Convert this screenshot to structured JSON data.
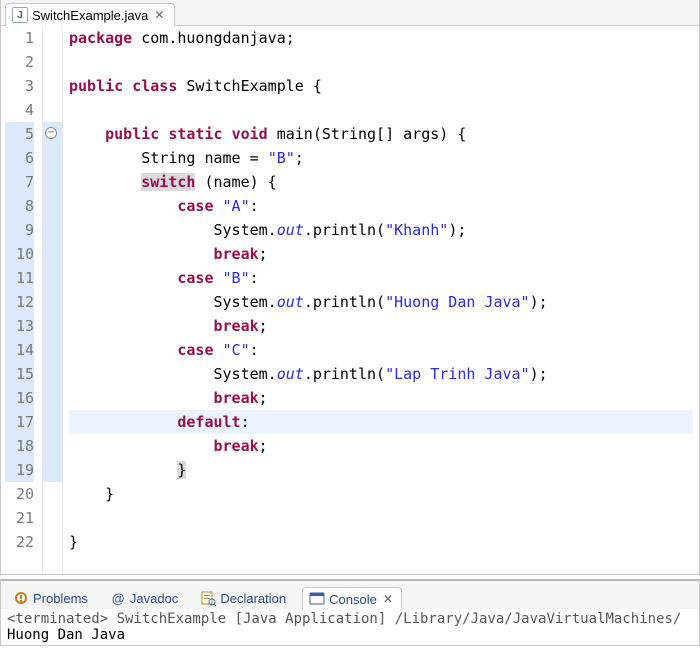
{
  "editor": {
    "tab": {
      "filename": "SwitchExample.java"
    },
    "lines": [
      {
        "n": 1,
        "segs": [
          [
            "kw",
            "package"
          ],
          [
            "pkg",
            " com.huongdanjava;"
          ]
        ]
      },
      {
        "n": 2,
        "segs": [
          [
            "",
            ""
          ]
        ]
      },
      {
        "n": 3,
        "segs": [
          [
            "kw",
            "public"
          ],
          [
            "",
            " "
          ],
          [
            "kw",
            "class"
          ],
          [
            "cls",
            " SwitchExample {"
          ]
        ]
      },
      {
        "n": 4,
        "segs": [
          [
            "",
            ""
          ]
        ]
      },
      {
        "n": 5,
        "fold": true,
        "bar": true,
        "segs": [
          [
            "",
            "    "
          ],
          [
            "kw",
            "public"
          ],
          [
            "",
            " "
          ],
          [
            "kw",
            "static"
          ],
          [
            "",
            " "
          ],
          [
            "kw",
            "void"
          ],
          [
            "",
            " main(String[] args) {"
          ]
        ]
      },
      {
        "n": 6,
        "bar": true,
        "segs": [
          [
            "",
            "        String name = "
          ],
          [
            "str",
            "\"B\""
          ],
          [
            "",
            ";"
          ]
        ]
      },
      {
        "n": 7,
        "bar": true,
        "segs": [
          [
            "",
            "        "
          ],
          [
            "kw box-hl",
            "switch"
          ],
          [
            "",
            " (name) {"
          ]
        ]
      },
      {
        "n": 8,
        "bar": true,
        "segs": [
          [
            "",
            "            "
          ],
          [
            "kw",
            "case"
          ],
          [
            "",
            " "
          ],
          [
            "str",
            "\"A\""
          ],
          [
            "",
            ":"
          ]
        ]
      },
      {
        "n": 9,
        "bar": true,
        "segs": [
          [
            "",
            "                System."
          ],
          [
            "field",
            "out"
          ],
          [
            "",
            ".println("
          ],
          [
            "str",
            "\"Khanh\""
          ],
          [
            "",
            ");"
          ]
        ]
      },
      {
        "n": 10,
        "bar": true,
        "segs": [
          [
            "",
            "                "
          ],
          [
            "kw",
            "break"
          ],
          [
            "",
            ";"
          ]
        ]
      },
      {
        "n": 11,
        "bar": true,
        "segs": [
          [
            "",
            "            "
          ],
          [
            "kw",
            "case"
          ],
          [
            "",
            " "
          ],
          [
            "str",
            "\"B\""
          ],
          [
            "",
            ":"
          ]
        ]
      },
      {
        "n": 12,
        "bar": true,
        "segs": [
          [
            "",
            "                System."
          ],
          [
            "field",
            "out"
          ],
          [
            "",
            ".println("
          ],
          [
            "str",
            "\"Huong Dan Java\""
          ],
          [
            "",
            ");"
          ]
        ]
      },
      {
        "n": 13,
        "bar": true,
        "segs": [
          [
            "",
            "                "
          ],
          [
            "kw",
            "break"
          ],
          [
            "",
            ";"
          ]
        ]
      },
      {
        "n": 14,
        "bar": true,
        "segs": [
          [
            "",
            "            "
          ],
          [
            "kw",
            "case"
          ],
          [
            "",
            " "
          ],
          [
            "str",
            "\"C\""
          ],
          [
            "",
            ":"
          ]
        ]
      },
      {
        "n": 15,
        "bar": true,
        "segs": [
          [
            "",
            "                System."
          ],
          [
            "field",
            "out"
          ],
          [
            "",
            ".println("
          ],
          [
            "str",
            "\"Lap Trinh Java\""
          ],
          [
            "",
            ");"
          ]
        ]
      },
      {
        "n": 16,
        "bar": true,
        "segs": [
          [
            "",
            "                "
          ],
          [
            "kw",
            "break"
          ],
          [
            "",
            ";"
          ]
        ]
      },
      {
        "n": 17,
        "bar": true,
        "hl": true,
        "segs": [
          [
            "",
            "            "
          ],
          [
            "kw",
            "default"
          ],
          [
            "",
            ":"
          ]
        ]
      },
      {
        "n": 18,
        "bar": true,
        "segs": [
          [
            "",
            "                "
          ],
          [
            "kw",
            "break"
          ],
          [
            "",
            ";"
          ]
        ]
      },
      {
        "n": 19,
        "bar": true,
        "segs": [
          [
            "",
            "            "
          ],
          [
            "box-hl",
            "}"
          ]
        ]
      },
      {
        "n": 20,
        "segs": [
          [
            "",
            "    }"
          ]
        ]
      },
      {
        "n": 21,
        "segs": [
          [
            "",
            ""
          ]
        ]
      },
      {
        "n": 22,
        "segs": [
          [
            "",
            "}"
          ]
        ]
      }
    ]
  },
  "views": {
    "problems": "Problems",
    "javadoc": "Javadoc",
    "declaration": "Declaration",
    "console": "Console"
  },
  "console": {
    "status": "<terminated> SwitchExample [Java Application] /Library/Java/JavaVirtualMachines/",
    "output": "Huong Dan Java"
  }
}
